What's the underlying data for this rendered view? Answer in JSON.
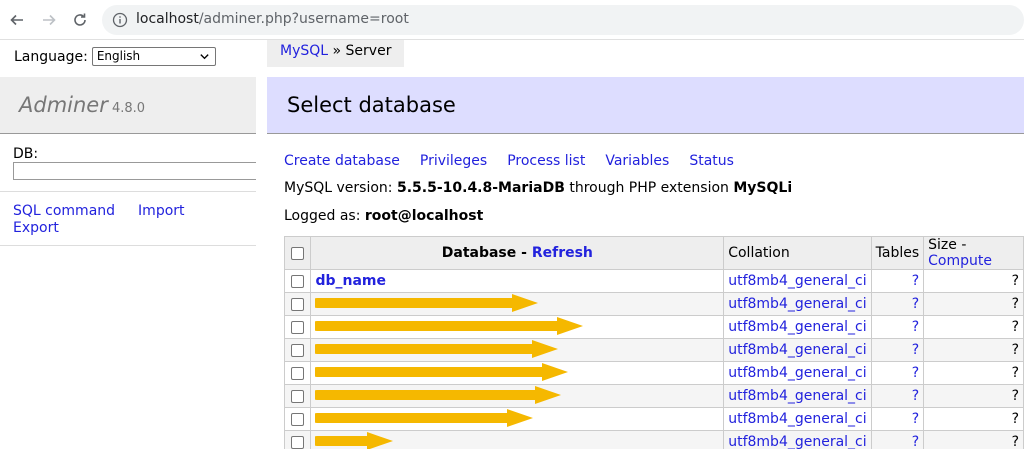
{
  "browser": {
    "url_host": "localhost",
    "url_path": "/adminer.php?username=root"
  },
  "sidebar": {
    "language_label": "Language:",
    "language_value": "English",
    "app_name": "Adminer",
    "app_version": "4.8.0",
    "db_label": "DB:",
    "db_value": "",
    "links": [
      "SQL command",
      "Import",
      "Export"
    ]
  },
  "breadcrumb": {
    "db_system": "MySQL",
    "separator": " » ",
    "current": "Server"
  },
  "heading": "Select database",
  "menu": [
    "Create database",
    "Privileges",
    "Process list",
    "Variables",
    "Status"
  ],
  "version_line": {
    "prefix": "MySQL version: ",
    "version": "5.5.5-10.4.8-MariaDB",
    "middle": " through PHP extension ",
    "extension": "MySQLi"
  },
  "logged": {
    "prefix": "Logged as: ",
    "user": "root@localhost"
  },
  "table": {
    "headers": {
      "database": "Database",
      "dash": " - ",
      "refresh": "Refresh",
      "collation": "Collation",
      "tables": "Tables",
      "size": "Size",
      "compute": "Compute"
    },
    "rows": [
      {
        "name": "db_name",
        "collation": "utf8mb4_general_ci",
        "tables": "?",
        "size": "?"
      },
      {
        "name": "",
        "collation": "utf8mb4_general_ci",
        "tables": "?",
        "size": "?"
      },
      {
        "name": "",
        "collation": "utf8mb4_general_ci",
        "tables": "?",
        "size": "?"
      },
      {
        "name": "",
        "collation": "utf8mb4_general_ci",
        "tables": "?",
        "size": "?"
      },
      {
        "name": "",
        "collation": "utf8mb4_general_ci",
        "tables": "?",
        "size": "?"
      },
      {
        "name": "",
        "collation": "utf8mb4_general_ci",
        "tables": "?",
        "size": "?"
      },
      {
        "name": "",
        "collation": "utf8mb4_general_ci",
        "tables": "?",
        "size": "?"
      },
      {
        "name": "",
        "collation": "utf8mb4_general_ci",
        "tables": "?",
        "size": "?"
      }
    ]
  },
  "colors": {
    "link": "#2222dd",
    "heading_bg": "#ddddff",
    "redaction": "#f5b800"
  },
  "icons": [
    "back-arrow-icon",
    "forward-arrow-icon",
    "reload-icon",
    "info-icon",
    "chevron-down-icon"
  ]
}
